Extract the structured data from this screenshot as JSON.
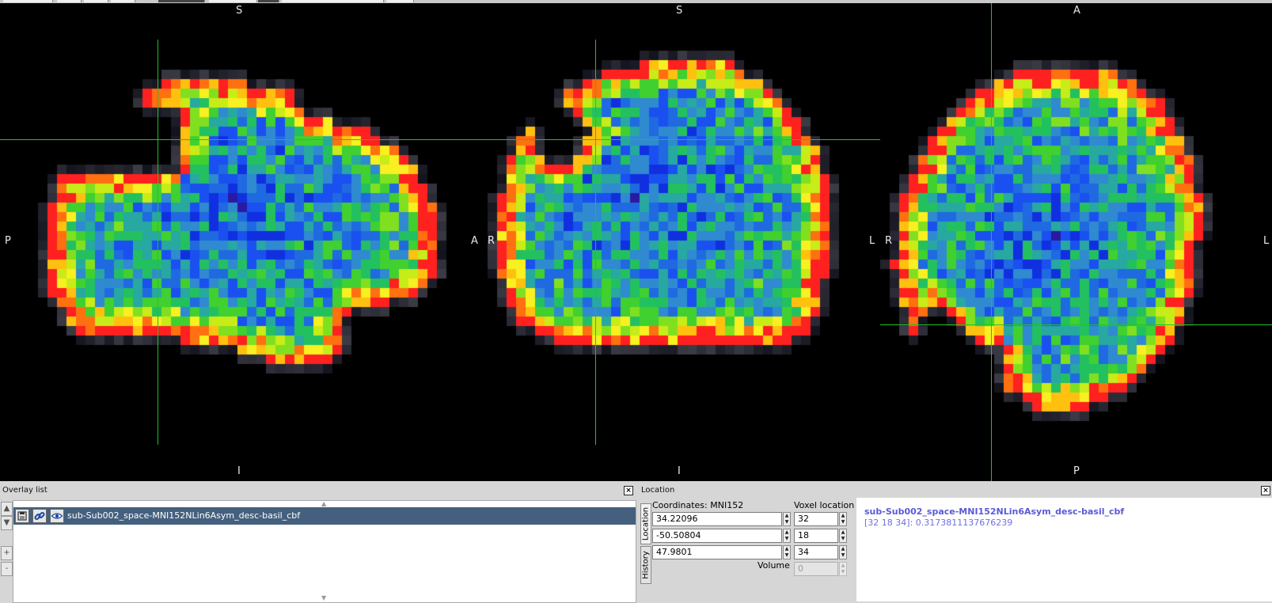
{
  "colors": {
    "canvas_bg": "#000000",
    "crosshair": "#22c22a",
    "selected_row": "#44607e",
    "info_text": "#5a5ad8"
  },
  "colormap": [
    "#1a0066",
    "#2a1aa0",
    "#1030e0",
    "#1a50f0",
    "#1f6ae0",
    "#2f8ad0",
    "#27a8a0",
    "#23c060",
    "#40d030",
    "#80e020",
    "#c8ec18",
    "#f8f020",
    "#ffc010",
    "#ff7010",
    "#ff2020"
  ],
  "views": [
    {
      "name": "sagittal",
      "labels": {
        "top": "S",
        "bottom": "I",
        "left": "P",
        "right": "A"
      }
    },
    {
      "name": "coronal",
      "labels": {
        "top": "S",
        "bottom": "I",
        "left": "R",
        "right": "L"
      }
    },
    {
      "name": "axial",
      "labels": {
        "top": "A",
        "bottom": "P",
        "left": "R",
        "right": "L"
      }
    }
  ],
  "overlay_list": {
    "title": "Overlay list",
    "close_icon": "x-icon",
    "side_buttons": [
      "up-arrow-icon",
      "down-arrow-icon",
      "+",
      "-"
    ],
    "row_icons": [
      "save-icon",
      "link-icon",
      "eye-icon"
    ],
    "items": [
      {
        "name": "sub-Sub002_space-MNI152NLin6Asym_desc-basil_cbf",
        "selected": true
      }
    ]
  },
  "location": {
    "title": "Location",
    "close_icon": "x-icon",
    "tabs": [
      "Location",
      "History"
    ],
    "coords_label": "Coordinates: MNI152",
    "voxel_label": "Voxel location",
    "volume_label": "Volume",
    "coords": [
      "34.22096",
      "-50.50804",
      "47.9801"
    ],
    "voxels": [
      "32",
      "18",
      "34"
    ],
    "volume": "0",
    "info_name": "sub-Sub002_space-MNI152NLin6Asym_desc-basil_cbf",
    "info_value": "[32 18 34]: 0.3173811137676239"
  }
}
